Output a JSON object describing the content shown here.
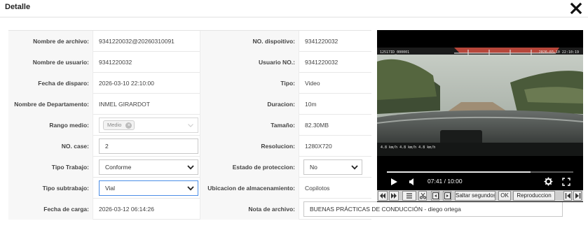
{
  "modal": {
    "title": "Detalle",
    "close_icon": "close-icon"
  },
  "form": {
    "file_name_label": "Nombre de archivo:",
    "file_name_value": "9341220032@20260310091",
    "device_label": "NO. dispoitivo:",
    "device_value": "9341220032",
    "user_name_label": "Nombre de usuario:",
    "user_name_value": "9341220032",
    "user_no_label": "Usuario NO.:",
    "user_no_value": "9341220032",
    "trigger_date_label": "Fecha de disparo:",
    "trigger_date_value": "2026-03-10 22:10:00",
    "type_label": "Tipo:",
    "type_value": "Video",
    "department_label": "Nombre de Departamento:",
    "department_value": "INMEL GIRARDOT",
    "duration_label": "Duracion:",
    "duration_value": "10m",
    "range_label": "Rango medio:",
    "range_tag": "Medio",
    "size_label": "Tamaño:",
    "size_value": "82.30MB",
    "case_label": "NO. case:",
    "case_value": "2",
    "resolution_label": "Resolucion:",
    "resolution_value": "1280X720",
    "work_type_label": "Tipo Trabajo:",
    "work_type_value": "Conforme",
    "protection_label": "Estado de proteccion:",
    "protection_value": "No",
    "subwork_label": "Tipo subtrabajo:",
    "subwork_value": "Vial",
    "storage_label": "Ubicacion de almacenamiento:",
    "storage_value": "Copilotos",
    "upload_date_label": "Fecha de carga:",
    "upload_date_value": "2026-03-12 06:14:26",
    "note_label": "Nota de archivo:",
    "note_value": "BUENAS PRÁCTICAS DE CONDUCCIÓN - diego ortega"
  },
  "player": {
    "osd_top_left": "12517ID_000001",
    "osd_top_right": "2026-03-10 22:10:19",
    "osd_bottom_left": "4.8 km/h  4.8 km/h  4.8 km/h",
    "time": "07:41 / 10:00",
    "progress": 0.77,
    "icons": [
      "play-icon",
      "volume-icon",
      "settings-icon",
      "fullscreen-icon"
    ]
  },
  "toolbar": {
    "skip_label": "Saltar segundos",
    "ok_label": "OK",
    "playback_label": "Reproduccion",
    "icons": [
      "rewind-icon",
      "fast-forward-icon",
      "list-icon",
      "cut-icon",
      "frame-back-icon",
      "frame-forward-icon",
      "skip-start-icon",
      "skip-end-icon"
    ]
  },
  "colors": {
    "focus_border": "#4c8ee6",
    "label_bg": "#f7f7f7",
    "player_bg": "#000000"
  }
}
